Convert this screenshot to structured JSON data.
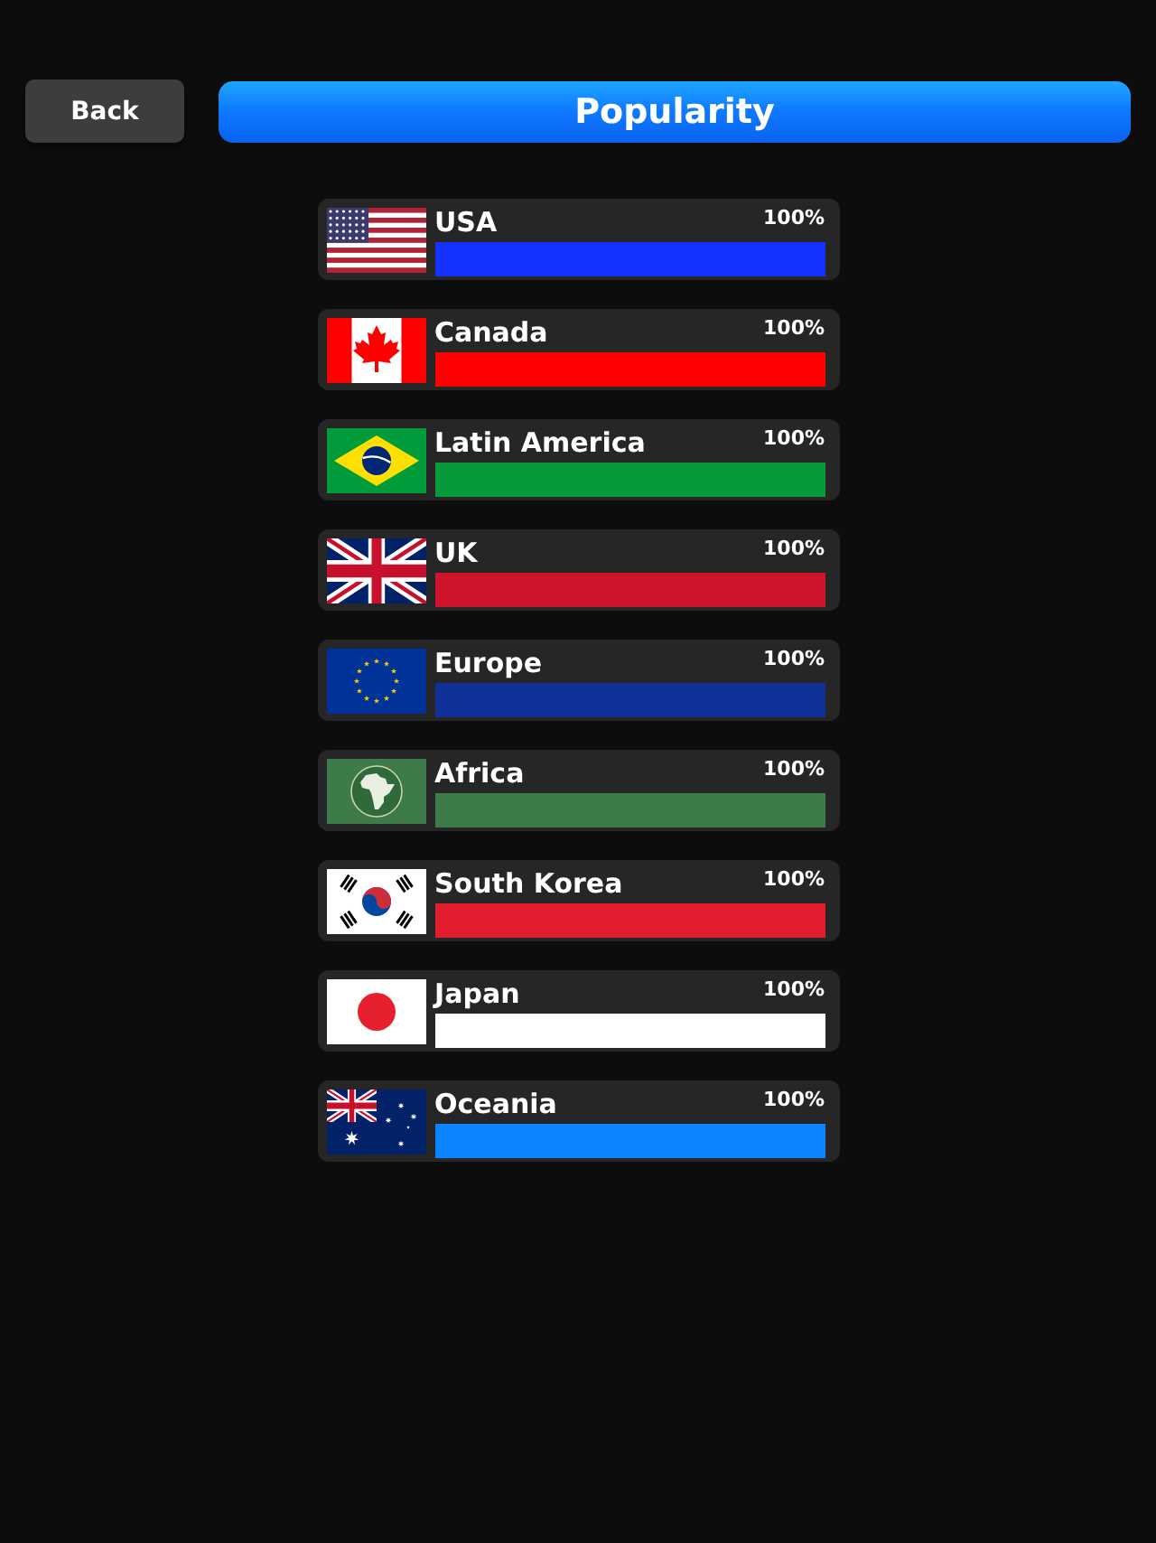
{
  "header": {
    "back_button": "Back",
    "title": "Popularity"
  },
  "regions": [
    {
      "name": "USA",
      "kind": "us",
      "percent": "100%",
      "level": 1,
      "color": "#1531ff"
    },
    {
      "name": "Canada",
      "kind": "canada",
      "percent": "100%",
      "level": 1,
      "color": "#ff0000"
    },
    {
      "name": "Latin America",
      "kind": "brazil",
      "percent": "100%",
      "level": 1,
      "color": "#079a3a"
    },
    {
      "name": "UK",
      "kind": "uk",
      "percent": "100%",
      "level": 1,
      "color": "#cf142b"
    },
    {
      "name": "Europe",
      "kind": "eu",
      "percent": "100%",
      "level": 1,
      "color": "#10319a"
    },
    {
      "name": "Africa",
      "kind": "africa",
      "percent": "100%",
      "level": 1,
      "color": "#3e7b4b"
    },
    {
      "name": "South Korea",
      "kind": "korea",
      "percent": "100%",
      "level": 1,
      "color": "#e31c2f"
    },
    {
      "name": "Japan",
      "kind": "japan",
      "percent": "100%",
      "level": 1,
      "color": "#ffffff"
    },
    {
      "name": "Oceania",
      "kind": "australia",
      "percent": "100%",
      "level": 1,
      "color": "#0a84ff"
    }
  ]
}
